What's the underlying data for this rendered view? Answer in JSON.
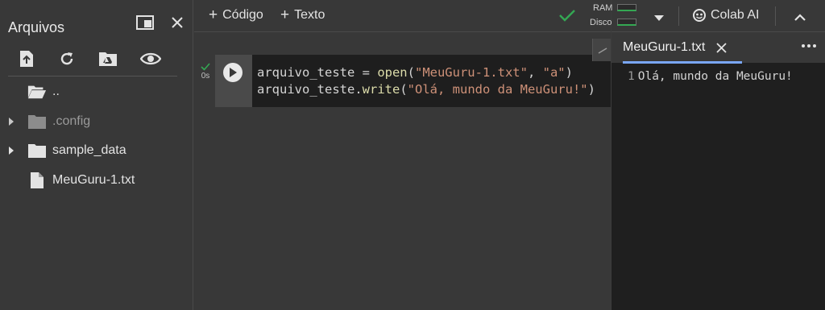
{
  "sidebar": {
    "title": "Arquivos",
    "files": [
      {
        "name": "..",
        "type": "folder-open",
        "expandable": false
      },
      {
        "name": ".config",
        "type": "folder",
        "expandable": true,
        "dim": true
      },
      {
        "name": "sample_data",
        "type": "folder",
        "expandable": true
      },
      {
        "name": "MeuGuru-1.txt",
        "type": "file",
        "expandable": false
      }
    ]
  },
  "toolbar": {
    "code_label": "Código",
    "text_label": "Texto",
    "ram_label": "RAM",
    "disk_label": "Disco",
    "colab_ai_label": "Colab AI"
  },
  "cell": {
    "line1_var": "arquivo_teste = ",
    "line1_fn": "open",
    "line1_open": "(",
    "line1_arg1": "\"MeuGuru-1.txt\"",
    "line1_sep": ", ",
    "line1_arg2": "\"a\"",
    "line1_close": ")",
    "line2_obj": "arquivo_teste.",
    "line2_fn": "write",
    "line2_open": "(",
    "line2_arg": "\"Olá, mundo da MeuGuru!\"",
    "line2_close": ")",
    "status_time": "0s"
  },
  "editor": {
    "tab_title": "MeuGuru-1.txt",
    "line_number": "1",
    "line_text": "Olá, mundo da MeuGuru!"
  },
  "colors": {
    "accent_blue": "#7aa7f7",
    "success_green": "#34a853"
  }
}
